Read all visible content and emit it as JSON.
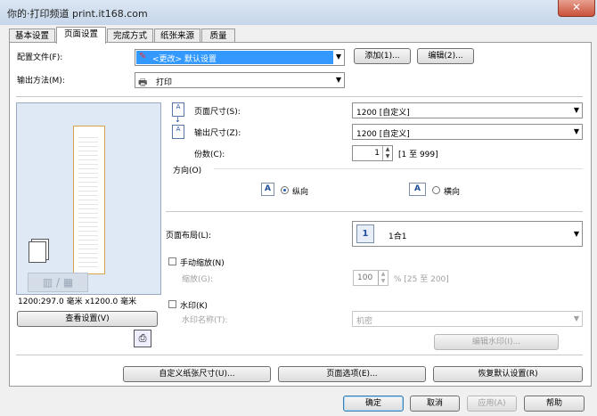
{
  "window": {
    "title": "你的·打印频道 print.it168.com",
    "close_glyph": "✕"
  },
  "tabs": [
    {
      "label": "基本设置"
    },
    {
      "label": "页面设置",
      "active": true
    },
    {
      "label": "完成方式"
    },
    {
      "label": "纸张来源"
    },
    {
      "label": "质量"
    }
  ],
  "profile": {
    "label": "配置文件(F):",
    "value": "<更改> 默认设置",
    "add_button": "添加(1)...",
    "edit_button": "编辑(2)..."
  },
  "output_method": {
    "label": "输出方法(M):",
    "value": "打印"
  },
  "preview": {
    "dimensions": "1200:297.0 毫米 x1200.0 毫米",
    "view_settings_button": "查看设置(V)"
  },
  "page_size": {
    "label": "页面尺寸(S):",
    "value": "1200 [自定义]"
  },
  "output_size": {
    "label": "输出尺寸(Z):",
    "value": "1200 [自定义]"
  },
  "copies": {
    "label": "份数(C):",
    "value": "1",
    "range": "[1 至 999]"
  },
  "orientation": {
    "label": "方向(O)",
    "portrait": "纵向",
    "landscape": "横向",
    "selected": "portrait"
  },
  "page_layout": {
    "label": "页面布局(L):",
    "icon_number": "1",
    "value": "1合1"
  },
  "manual_scaling": {
    "label": "手动缩放(N)",
    "scale_label": "缩放(G):",
    "value": "100",
    "range": "% [25 至 200]"
  },
  "watermark": {
    "label": "水印(K)",
    "name_label": "水印名称(T):",
    "name_value": "机密",
    "edit_button": "编辑水印(I)..."
  },
  "bottom_buttons": {
    "custom_paper": "自定义纸张尺寸(U)...",
    "page_options": "页面选项(E)...",
    "restore_defaults": "恢复默认设置(R)"
  },
  "dialog_buttons": {
    "ok": "确定",
    "cancel": "取消",
    "apply": "应用(A)",
    "help": "帮助"
  },
  "colors": {
    "accent": "#3399ff",
    "panel_bg": "#f0f0f0",
    "preview_bg": "#dfe9f6"
  }
}
